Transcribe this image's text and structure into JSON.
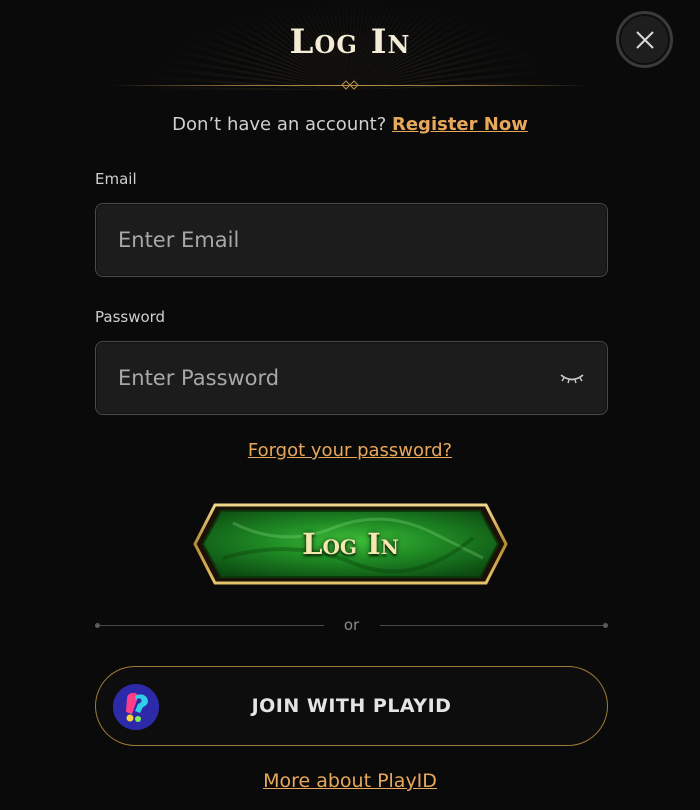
{
  "header": {
    "title": "Log In",
    "close_icon": "close-icon"
  },
  "register": {
    "prompt": "Don’t have an account?",
    "link_label": "Register Now"
  },
  "form": {
    "email_label": "Email",
    "email_placeholder": "Enter Email",
    "email_value": "",
    "password_label": "Password",
    "password_placeholder": "Enter Password",
    "password_value": "",
    "password_toggle_icon": "eye-closed-icon",
    "forgot_label": "Forgot your password?",
    "submit_label": "Log In"
  },
  "separator": {
    "label": "or"
  },
  "playid": {
    "button_label": "JOIN WITH PLAYID",
    "logo_icon": "playid-logo",
    "more_label": "More about PlayID"
  },
  "colors": {
    "background": "#0a0a0a",
    "accent_link": "#e8a85c",
    "gold_border": "#a07a3a",
    "button_green": "#1f8a24",
    "button_gold_frame": "#d9b45a",
    "title_text": "#f4ecd6"
  }
}
